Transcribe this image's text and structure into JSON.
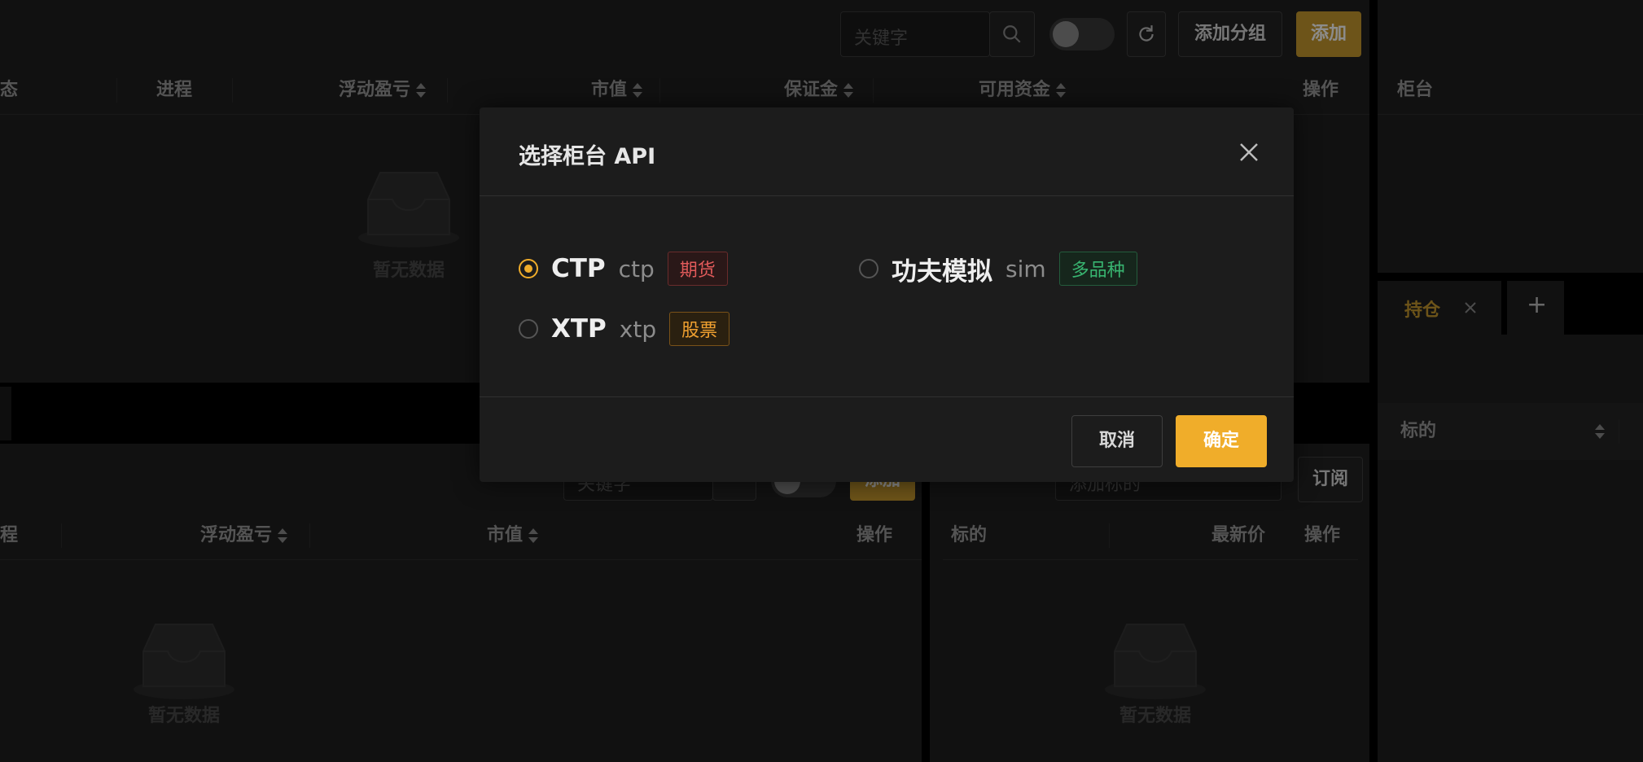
{
  "top_panel": {
    "search_placeholder": "关键字",
    "add_group_label": "添加分组",
    "add_label": "添加",
    "columns": [
      "态",
      "进程",
      "浮动盈亏",
      "市值",
      "保证金",
      "可用资金",
      "操作"
    ],
    "empty_text": "暂无数据"
  },
  "right_panel": {
    "column": "柜台",
    "tab_label": "持仓",
    "add_tab": "+",
    "column2": "标的"
  },
  "bottom_left": {
    "search_placeholder": "关键字",
    "add_label": "添加",
    "columns": [
      "程",
      "浮动盈亏",
      "市值",
      "操作"
    ],
    "empty_text": "暂无数据"
  },
  "bottom_mid": {
    "select_placeholder": "添加标的",
    "subscribe_label": "订阅",
    "columns": [
      "标的",
      "最新价",
      "操作"
    ],
    "empty_text": "暂无数据"
  },
  "modal": {
    "title": "选择柜台 API",
    "options": [
      {
        "name": "CTP",
        "key": "ctp",
        "tag": "期货",
        "tag_color": "#e05a5a",
        "checked": true
      },
      {
        "name": "功夫模拟",
        "key": "sim",
        "tag": "多品种",
        "tag_color": "#38b470",
        "checked": false
      },
      {
        "name": "XTP",
        "key": "xtp",
        "tag": "股票",
        "tag_color": "#f0a030",
        "checked": false
      }
    ],
    "cancel_label": "取消",
    "confirm_label": "确定"
  },
  "colors": {
    "accent": "#f0ad2a",
    "primary_button": "#c79a2e"
  }
}
